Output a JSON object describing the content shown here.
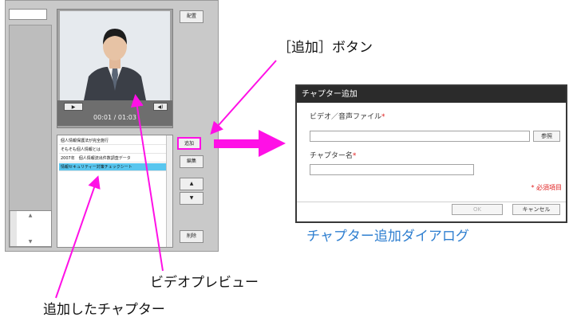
{
  "editor": {
    "top_right_button": "配置",
    "controls": {
      "play": "▶",
      "volume": "◀)",
      "timecode": "00:01 / 01:03"
    },
    "side_buttons": {
      "add": "追加",
      "edit": "編集",
      "up": "▲",
      "down": "▼",
      "delete": "削除"
    },
    "chapters": [
      {
        "text": "個人情報保護法が完全施行",
        "selected": false
      },
      {
        "text": "そもそも個人情報とは",
        "selected": false
      },
      {
        "text": "2007年　個人情報流出件数調査データ",
        "selected": false
      },
      {
        "text": "情報セキュリティー対策チェックシート",
        "selected": true
      }
    ],
    "scroll_up": "▲",
    "scroll_down": "▼"
  },
  "annotations": {
    "add_button": "［追加］ボタン",
    "dialog_caption": "チャプター追加ダイアログ",
    "video_preview": "ビデオプレビュー",
    "added_chapter": "追加したチャプター"
  },
  "dialog": {
    "title": "チャプター追加",
    "file_label": "ビデオ／音声ファイル",
    "browse_button": "参照",
    "name_label": "チャプター名",
    "required_mark": "*",
    "required_note": "* 必須項目",
    "ok_button": "OK",
    "cancel_button": "キャンセル"
  },
  "colors": {
    "annotation_arrow": "#ff10e6",
    "selected_row": "#58c6ef",
    "caption_blue": "#2f7fd0"
  }
}
